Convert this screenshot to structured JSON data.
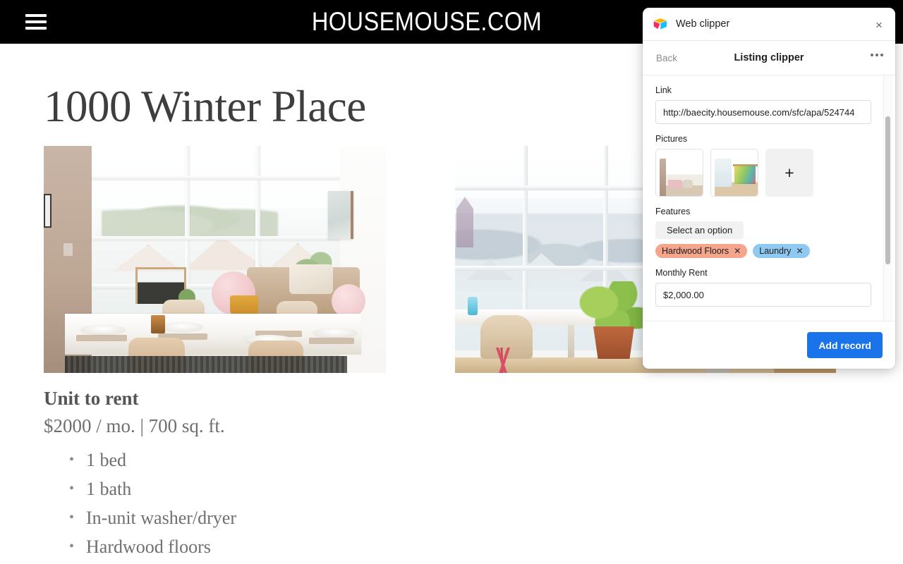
{
  "site": {
    "brand": "HOUSEMOUSE.COM",
    "menu_icon": "hamburger-menu-icon"
  },
  "listing": {
    "title": "1000 Winter Place",
    "section_heading": "Unit to rent",
    "summary": "$2000 / mo. | 700 sq. ft.",
    "features": [
      "1 bed",
      "1 bath",
      "In-unit washer/dryer",
      "Hardwood floors"
    ],
    "photos": [
      {
        "alt": "Bright dining room with large windows and set table"
      },
      {
        "alt": "Corner window with plants, shelf and framed art"
      }
    ]
  },
  "clipper": {
    "app_title": "Web clipper",
    "app_icon": "airtable-logo-icon",
    "close_label": "×",
    "back_label": "Back",
    "screen_title": "Listing clipper",
    "more_icon": "overflow-menu-icon",
    "fields": {
      "link": {
        "label": "Link",
        "value": "http://baecity.housemouse.com/sfc/apa/524744"
      },
      "pictures": {
        "label": "Pictures",
        "add_label": "+",
        "items": [
          {
            "alt": "dining room thumbnail"
          },
          {
            "alt": "corner window thumbnail"
          }
        ]
      },
      "features": {
        "label": "Features",
        "select_placeholder": "Select an option",
        "tags": [
          {
            "label": "Hardwood Floors",
            "color": "#f4a58c",
            "remove": "✕"
          },
          {
            "label": "Laundry",
            "color": "#8fc9f2",
            "remove": "✕"
          }
        ]
      },
      "monthly_rent": {
        "label": "Monthly Rent",
        "value": "$2,000.00"
      }
    },
    "footer": {
      "submit_label": "Add record",
      "submit_color": "#1a73e8"
    }
  }
}
